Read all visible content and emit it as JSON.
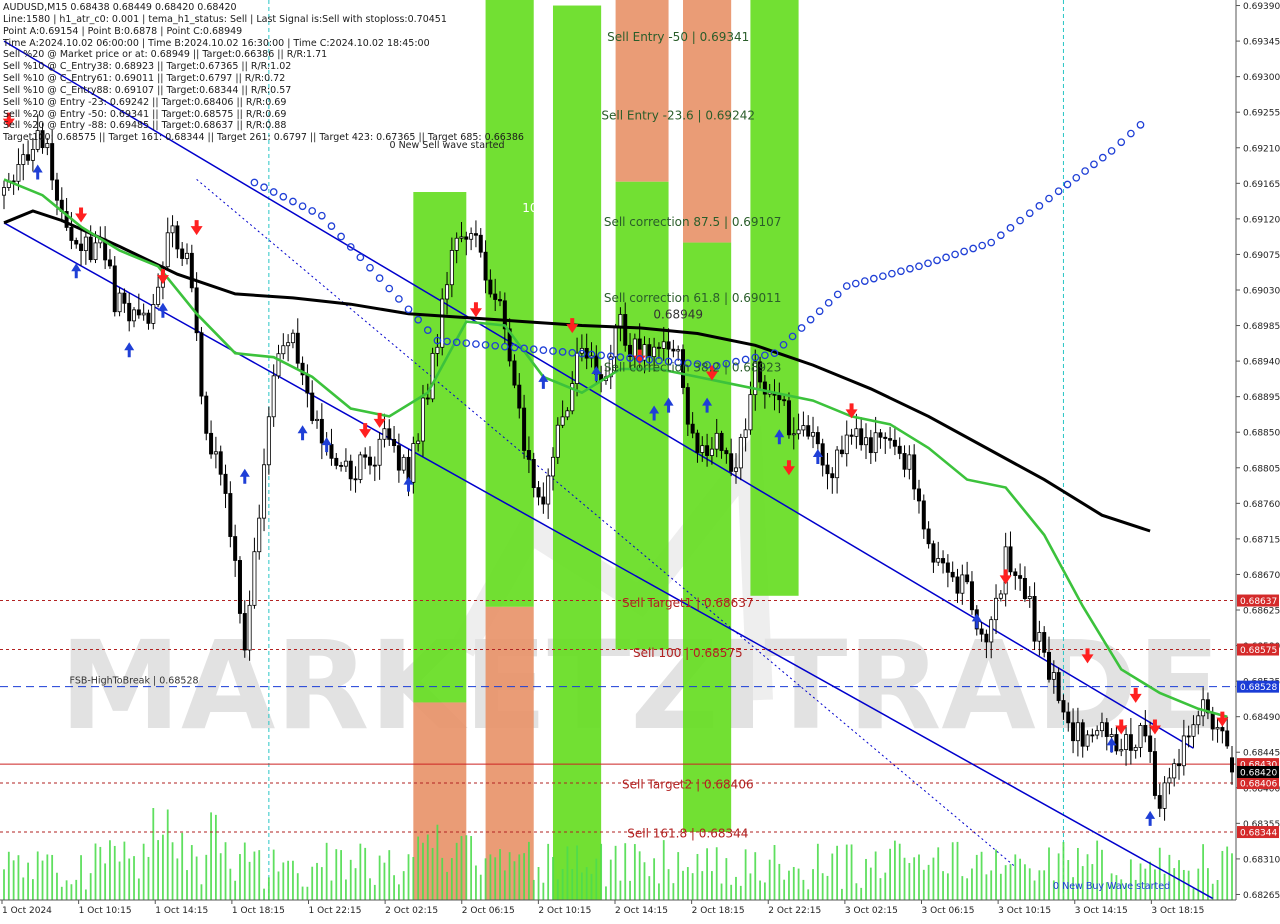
{
  "header": {
    "info_lines": [
      "AUDUSD,M15  0.68438 0.68449 0.68420 0.68420",
      "Line:1580  | h1_atr_c0: 0.001  | tema_h1_status: Sell  | Last Signal is:Sell with stoploss:0.70451",
      "Point A:0.69154 | Point B:0.6878 | Point C:0.68949",
      "Time A:2024.10.02 06:00:00 | Time B:2024.10.02 16:30:00 | Time C:2024.10.02 18:45:00",
      "Sell %20 @ Market price or at: 0.68949 || Target:0.66386 || R/R:1.71",
      "Sell %10 @ C_Entry38: 0.68923 || Target:0.67365 || R/R:1.02",
      "Sell %10 @ C_Entry61: 0.69011 || Target:0.6797 || R/R:0.72",
      "Sell %10 @ C_Entry88: 0.69107 || Target:0.68344 || R/R:0.57",
      "Sell %10 @ Entry -23: 0.69242 || Target:0.68406 || R/R:0.69",
      "Sell %20 @ Entry -50: 0.69341 || Target:0.68575 || R/R:0.69",
      "Sell %20 @ Entry -88: 0.69485 || Target:0.68637 || R/R:0.88",
      "Target100: 0.68575 || Target 161: 0.68344 || Target 261: 0.6797 || Target 423: 0.67365 || Target 685: 0.66386"
    ]
  },
  "colors": {
    "sell_zone": "#66dd22",
    "entry_zone": "#e8946a",
    "ma_slow": "#000000",
    "ma_fast": "#3cc23c",
    "channel": "#0000cc",
    "level_red": "#b22222",
    "level_blue": "#1a3cd6",
    "price_tag": "#d42a2a",
    "current_tag": "#000000",
    "arrow_sell": "#ff2020",
    "arrow_buy": "#1f3fd6",
    "volume": "#4edc4e",
    "watermark": "#d9d9d9"
  },
  "watermark": "MARKETZITRADE",
  "chart_data": {
    "type": "candlestick",
    "symbol": "AUDUSD",
    "timeframe": "M15",
    "ohlc_current": {
      "open": 0.68438,
      "high": 0.68449,
      "low": 0.6842,
      "close": 0.6842
    },
    "ylim": [
      0.68258,
      0.69397
    ],
    "y_ticks": [
      "0.69390",
      "0.69345",
      "0.69300",
      "0.69255",
      "0.69210",
      "0.69165",
      "0.69120",
      "0.69075",
      "0.69030",
      "0.68985",
      "0.68940",
      "0.68895",
      "0.68850",
      "0.68805",
      "0.68760",
      "0.68715",
      "0.68670",
      "0.68625",
      "0.68580",
      "0.68535",
      "0.68490",
      "0.68445",
      "0.68400",
      "0.68355",
      "0.68310",
      "0.68265"
    ],
    "x_ticks": [
      "1 Oct 2024",
      "1 Oct 10:15",
      "1 Oct 14:15",
      "1 Oct 18:15",
      "1 Oct 22:15",
      "2 Oct 02:15",
      "2 Oct 06:15",
      "2 Oct 10:15",
      "2 Oct 14:15",
      "2 Oct 18:15",
      "2 Oct 22:15",
      "3 Oct 02:15",
      "3 Oct 06:15",
      "3 Oct 10:15",
      "3 Oct 14:15",
      "3 Oct 18:15"
    ],
    "close_path": [
      [
        0,
        0.6915
      ],
      [
        4,
        0.692
      ],
      [
        8,
        0.6923
      ],
      [
        12,
        0.6912
      ],
      [
        16,
        0.6908
      ],
      [
        20,
        0.6909
      ],
      [
        23,
        0.6902
      ],
      [
        26,
        0.6901
      ],
      [
        30,
        0.69
      ],
      [
        34,
        0.691
      ],
      [
        38,
        0.6907
      ],
      [
        42,
        0.6886
      ],
      [
        46,
        0.6878
      ],
      [
        50,
        0.6858
      ],
      [
        53,
        0.6875
      ],
      [
        56,
        0.6893
      ],
      [
        60,
        0.6896
      ],
      [
        64,
        0.6888
      ],
      [
        68,
        0.6883
      ],
      [
        72,
        0.6879
      ],
      [
        76,
        0.6882
      ],
      [
        80,
        0.6884
      ],
      [
        84,
        0.688
      ],
      [
        88,
        0.689
      ],
      [
        92,
        0.6905
      ],
      [
        96,
        0.6911
      ],
      [
        100,
        0.6906
      ],
      [
        104,
        0.6899
      ],
      [
        108,
        0.6882
      ],
      [
        112,
        0.6876
      ],
      [
        116,
        0.6887
      ],
      [
        120,
        0.6895
      ],
      [
        124,
        0.6892
      ],
      [
        128,
        0.6899
      ],
      [
        132,
        0.6894
      ],
      [
        136,
        0.6897
      ],
      [
        140,
        0.6895
      ],
      [
        144,
        0.6881
      ],
      [
        148,
        0.6886
      ],
      [
        152,
        0.688
      ],
      [
        156,
        0.6892
      ],
      [
        160,
        0.6889
      ],
      [
        164,
        0.6885
      ],
      [
        168,
        0.6883
      ],
      [
        172,
        0.688
      ],
      [
        176,
        0.6886
      ],
      [
        180,
        0.6883
      ],
      [
        184,
        0.6885
      ],
      [
        188,
        0.6881
      ],
      [
        192,
        0.687
      ],
      [
        196,
        0.6868
      ],
      [
        200,
        0.6865
      ],
      [
        204,
        0.6859
      ],
      [
        208,
        0.6869
      ],
      [
        212,
        0.6865
      ],
      [
        216,
        0.6856
      ],
      [
        220,
        0.685
      ],
      [
        224,
        0.6845
      ],
      [
        228,
        0.6849
      ],
      [
        232,
        0.6844
      ],
      [
        236,
        0.6848
      ],
      [
        240,
        0.6838
      ],
      [
        244,
        0.6844
      ],
      [
        248,
        0.6851
      ],
      [
        252,
        0.6847
      ],
      [
        255,
        0.6842
      ]
    ],
    "ma_slow": [
      [
        0,
        0.69115
      ],
      [
        6,
        0.6913
      ],
      [
        12,
        0.69118
      ],
      [
        24,
        0.69085
      ],
      [
        36,
        0.6905
      ],
      [
        48,
        0.69025
      ],
      [
        60,
        0.6902
      ],
      [
        72,
        0.69012
      ],
      [
        84,
        0.69
      ],
      [
        96,
        0.68995
      ],
      [
        108,
        0.6899
      ],
      [
        120,
        0.68985
      ],
      [
        132,
        0.68982
      ],
      [
        144,
        0.68975
      ],
      [
        156,
        0.6896
      ],
      [
        168,
        0.68935
      ],
      [
        180,
        0.68905
      ],
      [
        192,
        0.6887
      ],
      [
        204,
        0.6883
      ],
      [
        216,
        0.6879
      ],
      [
        228,
        0.68745
      ],
      [
        238,
        0.68725
      ]
    ],
    "ma_fast": [
      [
        0,
        0.6917
      ],
      [
        8,
        0.6915
      ],
      [
        16,
        0.6911
      ],
      [
        24,
        0.6908
      ],
      [
        32,
        0.6906
      ],
      [
        40,
        0.69
      ],
      [
        48,
        0.6895
      ],
      [
        56,
        0.68945
      ],
      [
        64,
        0.6892
      ],
      [
        72,
        0.6888
      ],
      [
        80,
        0.6887
      ],
      [
        88,
        0.689
      ],
      [
        96,
        0.6899
      ],
      [
        104,
        0.68985
      ],
      [
        112,
        0.6892
      ],
      [
        120,
        0.689
      ],
      [
        128,
        0.6893
      ],
      [
        136,
        0.6893
      ],
      [
        144,
        0.6892
      ],
      [
        152,
        0.6891
      ],
      [
        160,
        0.689
      ],
      [
        168,
        0.6889
      ],
      [
        176,
        0.6887
      ],
      [
        184,
        0.6886
      ],
      [
        192,
        0.6883
      ],
      [
        200,
        0.6879
      ],
      [
        208,
        0.6878
      ],
      [
        216,
        0.6872
      ],
      [
        224,
        0.6863
      ],
      [
        232,
        0.6855
      ],
      [
        240,
        0.6852
      ],
      [
        248,
        0.685
      ],
      [
        254,
        0.6849
      ]
    ],
    "channel": {
      "upper": [
        [
          0,
          0.69345
        ],
        [
          247,
          0.6845
        ]
      ],
      "lower": [
        [
          0,
          0.69115
        ],
        [
          251,
          0.6826
        ]
      ],
      "mid_dotted": [
        [
          40,
          0.6917
        ],
        [
          210,
          0.683
        ]
      ]
    },
    "levels": [
      {
        "label": "Sell Target1 | 0.68637",
        "value": 0.68637,
        "tag": "0.68637",
        "style": "dotted",
        "color": "#b22222"
      },
      {
        "label": "Sell 100 | 0.68575",
        "value": 0.68575,
        "tag": "0.68575",
        "style": "dotted",
        "color": "#b22222"
      },
      {
        "label": "FSB-HighToBreak | 0.68528",
        "value": 0.68528,
        "tag": "0.68528",
        "style": "dashed",
        "color": "#1a3cd6"
      },
      {
        "label": "",
        "value": 0.6843,
        "tag": "0.68430",
        "style": "solid",
        "color": "#cc2222"
      },
      {
        "label": "Sell Target2 | 0.68406",
        "value": 0.68406,
        "tag": "0.68406",
        "style": "dotted",
        "color": "#b22222"
      },
      {
        "label": "Sell 161.8 | 0.68344",
        "value": 0.68344,
        "tag": "0.68344",
        "style": "dotted",
        "color": "#b22222"
      }
    ],
    "current_price": {
      "value": 0.6842,
      "tag": "0.68420"
    },
    "zones": [
      {
        "kind": "sell",
        "x0": 85,
        "x1": 96,
        "y_top": 0.69154,
        "y_bottom": 0.68508
      },
      {
        "kind": "entry",
        "x0": 85,
        "x1": 96,
        "y_top": 0.68508,
        "y_bottom": 0.68258
      },
      {
        "kind": "sell",
        "x0": 100,
        "x1": 110,
        "y_top": 0.69397,
        "y_bottom": 0.68629
      },
      {
        "kind": "entry",
        "x0": 100,
        "x1": 110,
        "y_top": 0.68629,
        "y_bottom": 0.68258
      },
      {
        "kind": "sell",
        "x0": 114,
        "x1": 124,
        "y_top": 0.6939,
        "y_bottom": 0.68258
      },
      {
        "kind": "entry",
        "x0": 127,
        "x1": 138,
        "y_top": 0.69397,
        "y_bottom": 0.69167
      },
      {
        "kind": "sell",
        "x0": 127,
        "x1": 138,
        "y_top": 0.69167,
        "y_bottom": 0.68575
      },
      {
        "kind": "entry",
        "x0": 141,
        "x1": 151,
        "y_top": 0.69397,
        "y_bottom": 0.6909
      },
      {
        "kind": "sell",
        "x0": 141,
        "x1": 151,
        "y_top": 0.6909,
        "y_bottom": 0.68344
      },
      {
        "kind": "sell",
        "x0": 155,
        "x1": 165,
        "y_top": 0.69397,
        "y_bottom": 0.68643
      }
    ],
    "vlines": [
      55,
      220
    ],
    "annotations": [
      {
        "text": "Sell Entry -50 | 0.69341",
        "x": 140,
        "y": 0.69341,
        "color": "#2a5d2a"
      },
      {
        "text": "Sell Entry -23.6 | 0.69242",
        "x": 140,
        "y": 0.69242,
        "color": "#2a5d2a"
      },
      {
        "text": "Sell correction 87.5 | 0.69107",
        "x": 143,
        "y": 0.69107,
        "color": "#2a5d2a"
      },
      {
        "text": "Sell correction 61.8 | 0.69011",
        "x": 143,
        "y": 0.69011,
        "color": "#2a5d2a"
      },
      {
        "text": "Sell correction 38.2 | 0.68923",
        "x": 143,
        "y": 0.68923,
        "color": "#2a5d2a"
      },
      {
        "text": "0.68949",
        "x": 140,
        "y": 0.6899,
        "color": "#333333"
      },
      {
        "text": "0 New Sell wave started",
        "x": 92,
        "y": 0.69206,
        "color": "#222222"
      },
      {
        "text": "100",
        "x": 110,
        "y": 0.69125,
        "color": "#ffffff"
      },
      {
        "text": "Sell Target1 | 0.68637",
        "x": 142,
        "y": 0.68625,
        "color": "#b22222"
      },
      {
        "text": "Sell 100 | 0.68575",
        "x": 142,
        "y": 0.68562,
        "color": "#b22222"
      },
      {
        "text": "Sell Target2 | 0.68406",
        "x": 142,
        "y": 0.68395,
        "color": "#b22222"
      },
      {
        "text": "Sell 161.8 | 0.68344",
        "x": 142,
        "y": 0.68333,
        "color": "#b22222"
      },
      {
        "text": "FSB-HighToBreak | 0.68528",
        "x": 27,
        "y": 0.68528,
        "color": "#333333"
      },
      {
        "text": "0 New Buy Wave started",
        "x": 230,
        "y": 0.68268,
        "color": "#1a3cd6"
      }
    ],
    "sell_arrows": [
      [
        1,
        0.69238
      ],
      [
        16,
        0.69118
      ],
      [
        40,
        0.69102
      ],
      [
        33,
        0.6904
      ],
      [
        75,
        0.68845
      ],
      [
        78,
        0.68858
      ],
      [
        98,
        0.68998
      ],
      [
        118,
        0.68978
      ],
      [
        132,
        0.68938
      ],
      [
        147,
        0.68918
      ],
      [
        163,
        0.68798
      ],
      [
        176,
        0.6887
      ],
      [
        208,
        0.6866
      ],
      [
        225,
        0.6856
      ],
      [
        232,
        0.6847
      ],
      [
        235,
        0.6851
      ],
      [
        239,
        0.6847
      ],
      [
        253,
        0.6848
      ]
    ],
    "buy_arrows": [
      [
        7,
        0.69185
      ],
      [
        15,
        0.6906
      ],
      [
        26,
        0.6896
      ],
      [
        33,
        0.6901
      ],
      [
        50,
        0.688
      ],
      [
        62,
        0.68855
      ],
      [
        67,
        0.6884
      ],
      [
        84,
        0.6879
      ],
      [
        112,
        0.6892
      ],
      [
        123,
        0.6893
      ],
      [
        135,
        0.6888
      ],
      [
        138,
        0.6889
      ],
      [
        146,
        0.6889
      ],
      [
        161,
        0.6885
      ],
      [
        169,
        0.68825
      ],
      [
        202,
        0.68617
      ],
      [
        230,
        0.6846
      ],
      [
        238,
        0.68367
      ]
    ],
    "circles_x": [
      [
        52,
        0.69166
      ],
      [
        66,
        0.69124
      ],
      [
        90,
        0.68966
      ],
      [
        148,
        0.68934
      ],
      [
        160,
        0.6895
      ],
      [
        175,
        0.69035
      ],
      [
        190,
        0.6906
      ],
      [
        205,
        0.6909
      ],
      [
        219,
        0.69155
      ],
      [
        230,
        0.69206
      ],
      [
        238,
        0.6925
      ]
    ],
    "volume_hint": "volume histogram along bottom"
  }
}
